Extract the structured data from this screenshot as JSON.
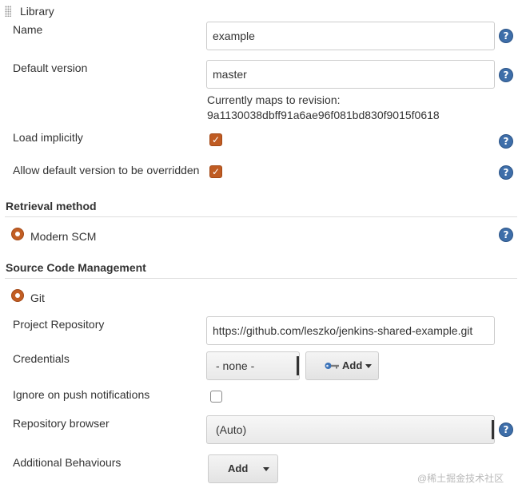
{
  "library": {
    "header": "Library",
    "name": {
      "label": "Name",
      "value": "example"
    },
    "default_version": {
      "label": "Default version",
      "value": "master",
      "revision_caption": "Currently maps to revision:",
      "revision_hash": "9a1130038dbff91a6ae96f081bd830f9015f0618"
    },
    "load_implicitly": {
      "label": "Load implicitly",
      "checked": true
    },
    "allow_override": {
      "label": "Allow default version to be overridden",
      "checked": true
    }
  },
  "retrieval": {
    "section_title": "Retrieval method",
    "option": "Modern SCM"
  },
  "scm": {
    "section_title": "Source Code Management",
    "option": "Git",
    "project_repository": {
      "label": "Project Repository",
      "value": "https://github.com/leszko/jenkins-shared-example.git"
    },
    "credentials": {
      "label": "Credentials",
      "selected": "- none -",
      "add_label": "Add"
    },
    "ignore_push": {
      "label": "Ignore on push notifications",
      "checked": false
    },
    "repository_browser": {
      "label": "Repository browser",
      "selected": "(Auto)"
    },
    "additional_behaviours": {
      "label": "Additional Behaviours",
      "add_label": "Add"
    }
  },
  "help_glyph": "?",
  "check_glyph": "✓",
  "watermark": "@稀土掘金技术社区",
  "colors": {
    "accent": "#bf5b22",
    "help": "#3e6ea9",
    "key": "#3b73b9"
  }
}
